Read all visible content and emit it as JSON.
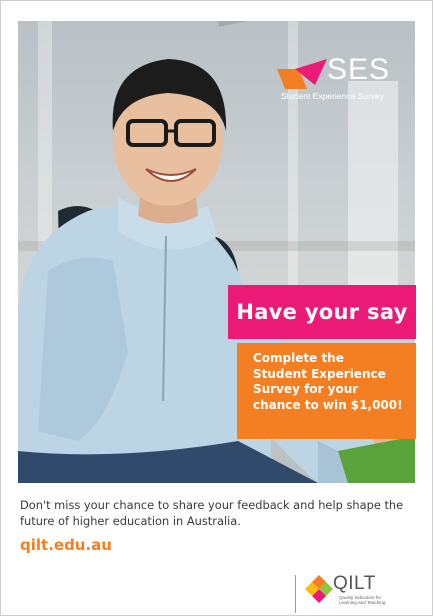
{
  "ses_logo": {
    "wordmark": "SES",
    "subtitle": "Student Experience Survey",
    "colors": {
      "chevron_orange": "#f47f22",
      "chevron_pink": "#ec1a77"
    }
  },
  "cta": {
    "headline": "Have your say",
    "body_lines": [
      "Complete the",
      "Student Experience",
      "Survey for your",
      "chance to win $1,000!"
    ],
    "colors": {
      "headline_bg": "#ec1a77",
      "body_bg": "#f47f22"
    }
  },
  "description": {
    "lines": [
      "Don't miss your chance to share your feedback and help shape the",
      "future of higher education in Australia."
    ]
  },
  "link": {
    "url": "qilt.edu.au",
    "color": "#f47f22"
  },
  "qilt_logo": {
    "wordmark": "QILT",
    "subtitle_lines": [
      "Quality Indicators for",
      "Learning and Teaching"
    ],
    "icon": "qilt-diamond-icon"
  }
}
